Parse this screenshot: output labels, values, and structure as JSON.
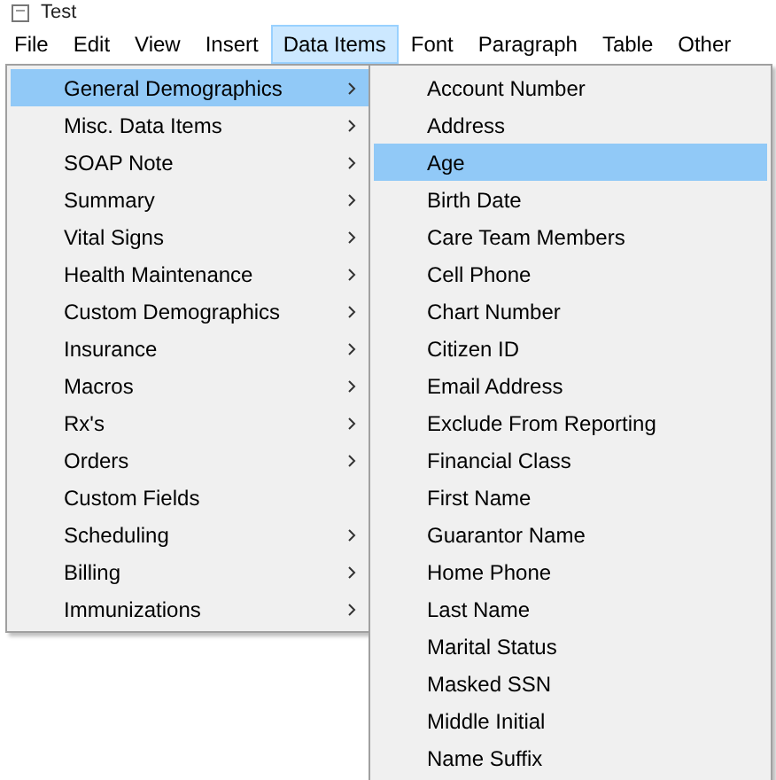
{
  "window": {
    "title": "Test"
  },
  "menubar": [
    {
      "label": "File",
      "selected": false
    },
    {
      "label": "Edit",
      "selected": false
    },
    {
      "label": "View",
      "selected": false
    },
    {
      "label": "Insert",
      "selected": false
    },
    {
      "label": "Data Items",
      "selected": true
    },
    {
      "label": "Font",
      "selected": false
    },
    {
      "label": "Paragraph",
      "selected": false
    },
    {
      "label": "Table",
      "selected": false
    },
    {
      "label": "Other",
      "selected": false
    }
  ],
  "menu": [
    {
      "label": "General Demographics",
      "has_submenu": true,
      "selected": true
    },
    {
      "label": "Misc. Data Items",
      "has_submenu": true,
      "selected": false
    },
    {
      "label": "SOAP Note",
      "has_submenu": true,
      "selected": false
    },
    {
      "label": "Summary",
      "has_submenu": true,
      "selected": false
    },
    {
      "label": "Vital Signs",
      "has_submenu": true,
      "selected": false
    },
    {
      "label": "Health Maintenance",
      "has_submenu": true,
      "selected": false
    },
    {
      "label": "Custom Demographics",
      "has_submenu": true,
      "selected": false
    },
    {
      "label": "Insurance",
      "has_submenu": true,
      "selected": false
    },
    {
      "label": "Macros",
      "has_submenu": true,
      "selected": false
    },
    {
      "label": "Rx's",
      "has_submenu": true,
      "selected": false
    },
    {
      "label": "Orders",
      "has_submenu": true,
      "selected": false
    },
    {
      "label": "Custom Fields",
      "has_submenu": false,
      "selected": false
    },
    {
      "label": "Scheduling",
      "has_submenu": true,
      "selected": false
    },
    {
      "label": "Billing",
      "has_submenu": true,
      "selected": false
    },
    {
      "label": "Immunizations",
      "has_submenu": true,
      "selected": false
    }
  ],
  "submenu": [
    {
      "label": "Account Number",
      "selected": false
    },
    {
      "label": "Address",
      "selected": false
    },
    {
      "label": "Age",
      "selected": true
    },
    {
      "label": "Birth Date",
      "selected": false
    },
    {
      "label": "Care Team Members",
      "selected": false
    },
    {
      "label": "Cell Phone",
      "selected": false
    },
    {
      "label": "Chart Number",
      "selected": false
    },
    {
      "label": "Citizen ID",
      "selected": false
    },
    {
      "label": "Email Address",
      "selected": false
    },
    {
      "label": "Exclude From Reporting",
      "selected": false
    },
    {
      "label": "Financial Class",
      "selected": false
    },
    {
      "label": "First Name",
      "selected": false
    },
    {
      "label": "Guarantor Name",
      "selected": false
    },
    {
      "label": "Home Phone",
      "selected": false
    },
    {
      "label": "Last Name",
      "selected": false
    },
    {
      "label": "Marital Status",
      "selected": false
    },
    {
      "label": "Masked SSN",
      "selected": false
    },
    {
      "label": "Middle Initial",
      "selected": false
    },
    {
      "label": "Name Suffix",
      "selected": false
    }
  ]
}
